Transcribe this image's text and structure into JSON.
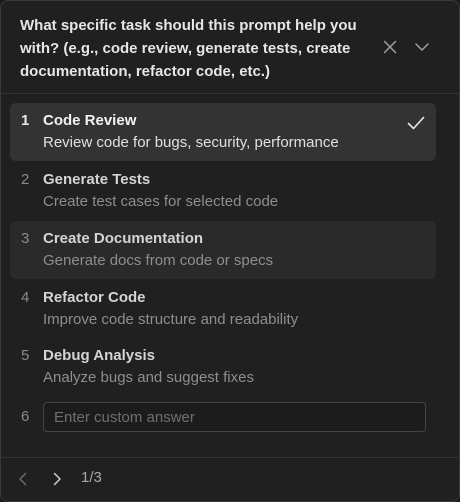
{
  "question": {
    "text": "What specific task should this prompt help you with? (e.g., code review, generate tests, create documentation, refactor code, etc.)"
  },
  "header_icons": {
    "close": "close-icon",
    "collapse": "chevron-down-icon"
  },
  "options": [
    {
      "number": "1",
      "title": "Code Review",
      "description": "Review code for bugs, security, performance",
      "selected": true
    },
    {
      "number": "2",
      "title": "Generate Tests",
      "description": "Create test cases for selected code",
      "selected": false
    },
    {
      "number": "3",
      "title": "Create Documentation",
      "description": "Generate docs from code or specs",
      "selected": false
    },
    {
      "number": "4",
      "title": "Refactor Code",
      "description": "Improve code structure and readability",
      "selected": false
    },
    {
      "number": "5",
      "title": "Debug Analysis",
      "description": "Analyze bugs and suggest fixes",
      "selected": false
    }
  ],
  "custom": {
    "number": "6",
    "placeholder": "Enter custom answer",
    "value": ""
  },
  "footer": {
    "pager": "1/3",
    "prev_icon": "chevron-left-icon",
    "next_icon": "chevron-right-icon"
  },
  "colors": {
    "panel_bg": "#202020",
    "selected_bg": "#333333",
    "hover_bg": "#2a2a2a",
    "text_primary": "#f2f2f2",
    "text_muted": "#8e8e8e"
  }
}
